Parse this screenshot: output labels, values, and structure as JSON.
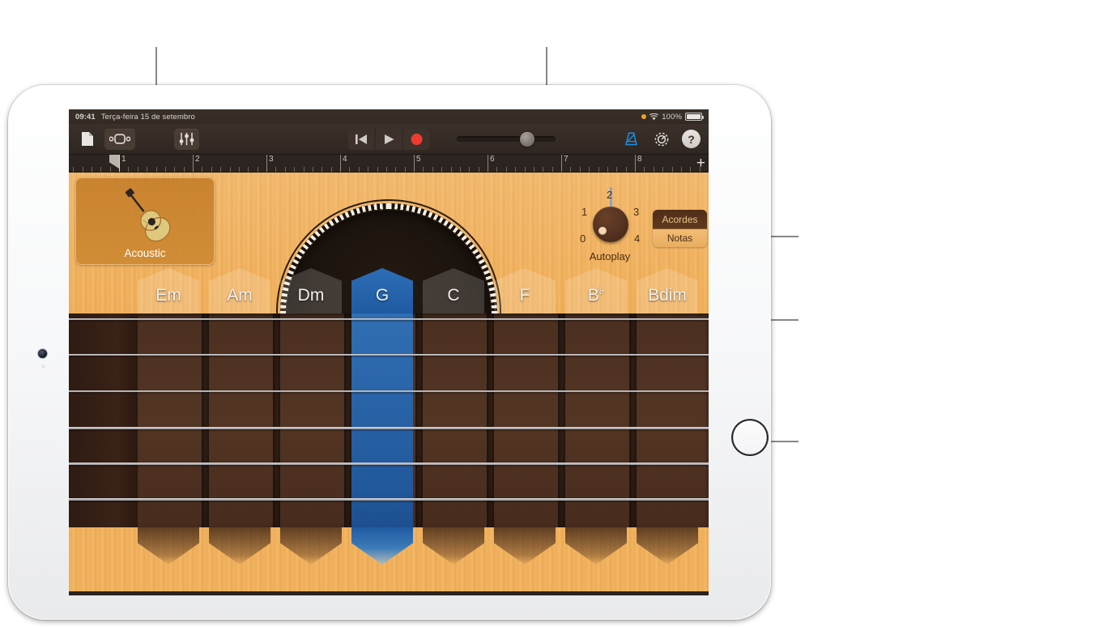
{
  "status_bar": {
    "time": "09:41",
    "date": "Terça-feira 15 de setembro",
    "battery_percent": "100%",
    "recording_dot": "orange-dot-icon",
    "wifi": "wifi-icon"
  },
  "toolbar": {
    "document_icon": "document-icon",
    "loops_icon": "loop-browser-icon",
    "mixer_icon": "track-controls-icon",
    "rewind_icon": "rewind-icon",
    "play_icon": "play-icon",
    "record_icon": "record-icon",
    "metronome_icon": "metronome-icon",
    "settings_icon": "gear-icon",
    "help_label": "?",
    "master_volume_value": 64
  },
  "ruler": {
    "bars": [
      "1",
      "2",
      "3",
      "4",
      "5",
      "6",
      "7",
      "8"
    ],
    "add_label": "+"
  },
  "instrument": {
    "label": "Acoustic",
    "icon": "acoustic-guitar-icon"
  },
  "autoplay": {
    "label": "Autoplay",
    "positions": [
      "0",
      "1",
      "2",
      "3",
      "4"
    ],
    "selected": "0"
  },
  "mode_switch": {
    "options": [
      {
        "label": "Acordes",
        "active": true
      },
      {
        "label": "Notas",
        "active": false
      }
    ]
  },
  "chords": [
    {
      "name": "Em",
      "root": "Em",
      "accidental": "",
      "selected": false
    },
    {
      "name": "Am",
      "root": "Am",
      "accidental": "",
      "selected": false
    },
    {
      "name": "Dm",
      "root": "Dm",
      "accidental": "",
      "selected": false
    },
    {
      "name": "G",
      "root": "G",
      "accidental": "",
      "selected": true
    },
    {
      "name": "C",
      "root": "C",
      "accidental": "",
      "selected": false
    },
    {
      "name": "F",
      "root": "F",
      "accidental": "",
      "selected": false
    },
    {
      "name": "Bb",
      "root": "B",
      "accidental": "♭",
      "selected": false
    },
    {
      "name": "Bdim",
      "root": "Bdim",
      "accidental": "",
      "selected": false
    }
  ],
  "fretboard": {
    "string_count": 6,
    "fret_count": 7
  },
  "colors": {
    "selected_chord": "#1f5ba3",
    "wood_light": "#f0b260",
    "wood_dark": "#4b2f20",
    "record_red": "#ef3b2f",
    "metronome_blue": "#1f8fe8",
    "callout_gray": "#86888a",
    "status_orange": "#f0a21c"
  }
}
